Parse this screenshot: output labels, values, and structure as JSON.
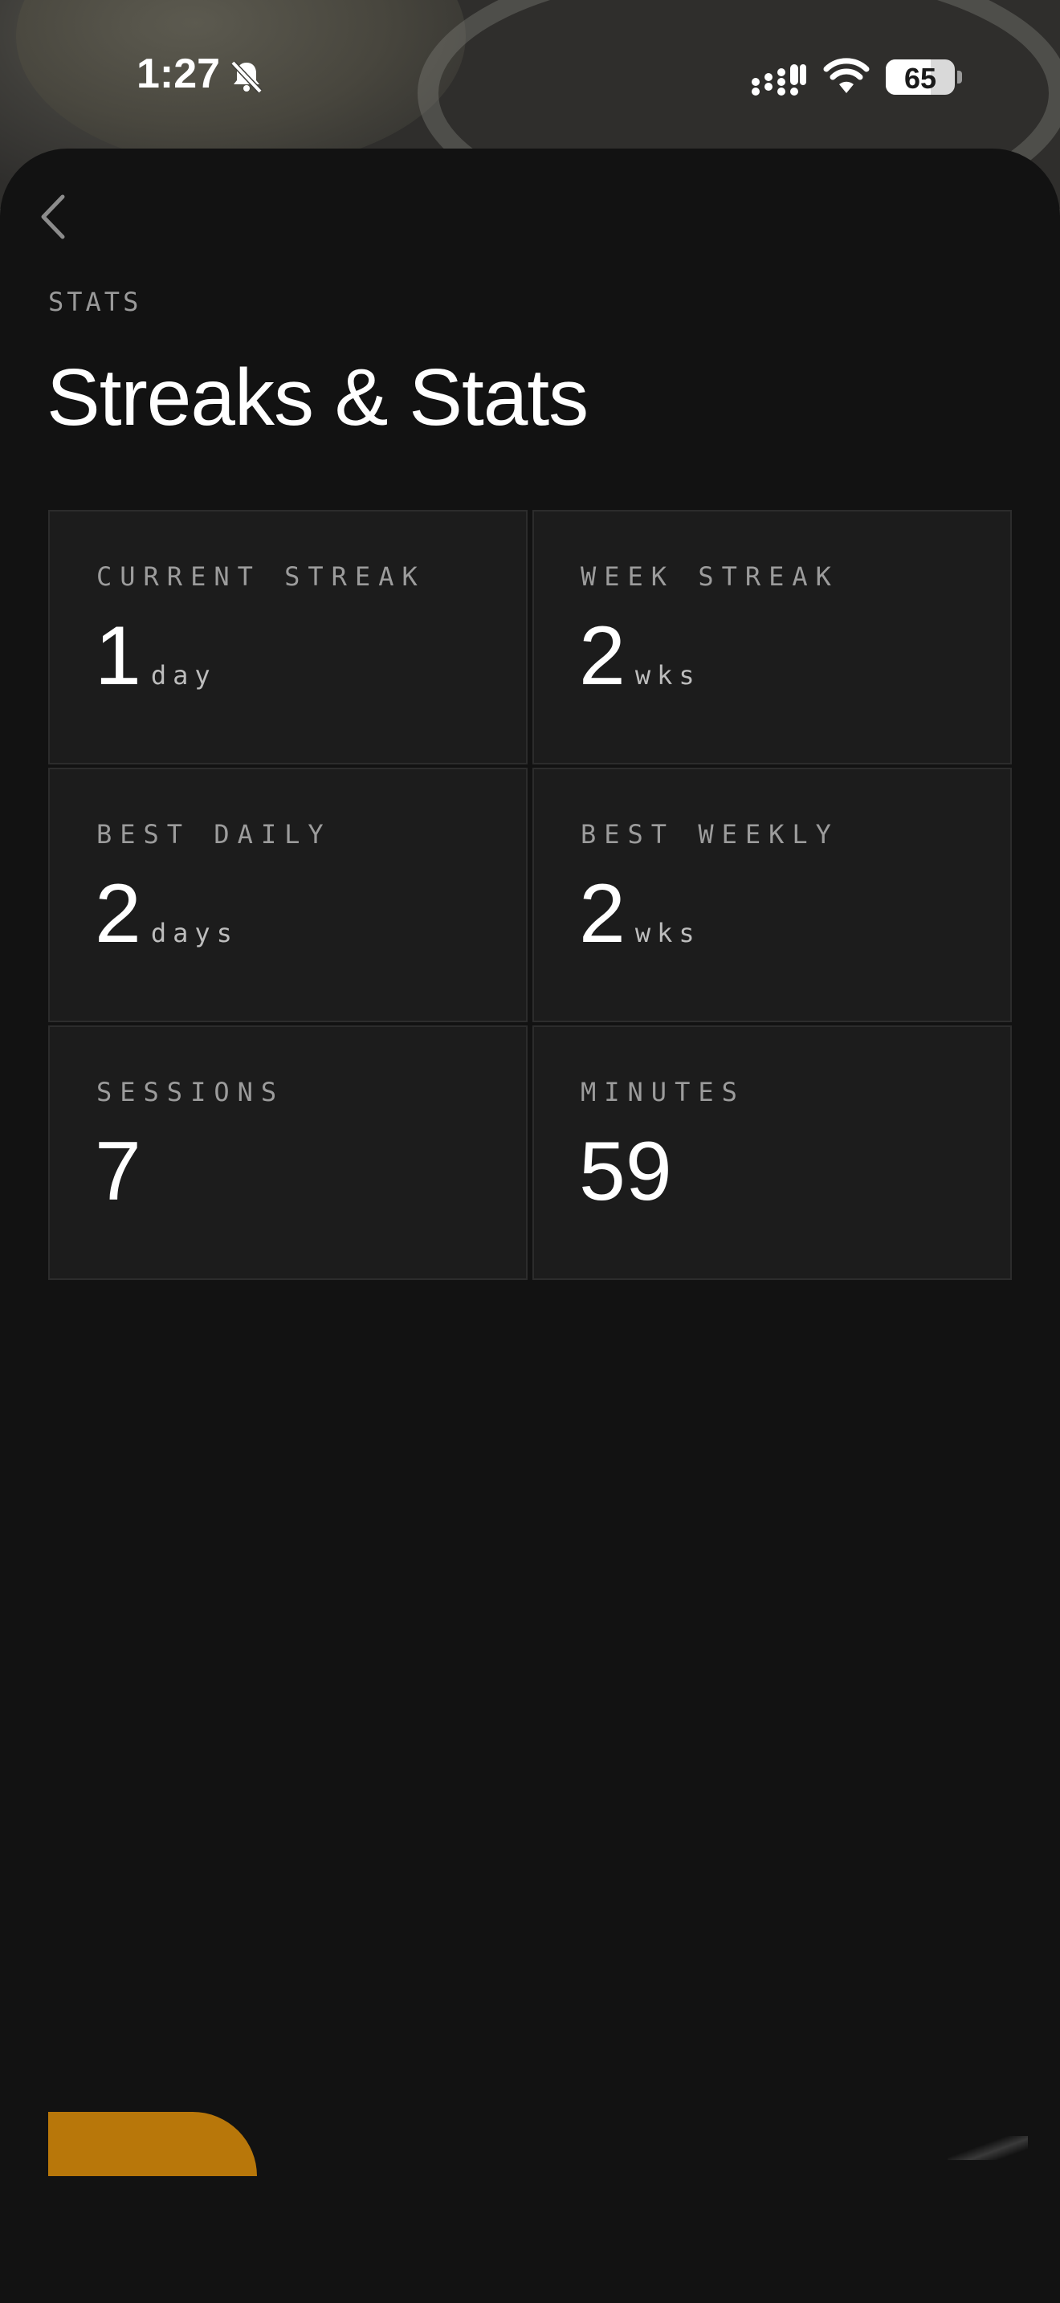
{
  "status_bar": {
    "time": "1:27",
    "battery_percent": "65",
    "battery_level": 0.65,
    "icons": [
      "bell-slash-icon",
      "signal-icon",
      "wifi-icon",
      "battery-icon"
    ]
  },
  "header": {
    "back_icon": "chevron-left-icon",
    "eyebrow": "STATS",
    "title": "Streaks & Stats"
  },
  "stats": [
    {
      "label": "CURRENT STREAK",
      "value": "1",
      "unit": "day"
    },
    {
      "label": "WEEK STREAK",
      "value": "2",
      "unit": "wks"
    },
    {
      "label": "BEST DAILY",
      "value": "2",
      "unit": "days"
    },
    {
      "label": "BEST WEEKLY",
      "value": "2",
      "unit": "wks"
    },
    {
      "label": "SESSIONS",
      "value": "7",
      "unit": ""
    },
    {
      "label": "MINUTES",
      "value": "59",
      "unit": ""
    }
  ],
  "colors": {
    "sheet_background": "#121212",
    "card_background": "#1c1c1c",
    "card_border": "#2c2c2c",
    "label_gray": "#9c9c9c",
    "accent_orange": "#b8770a"
  }
}
